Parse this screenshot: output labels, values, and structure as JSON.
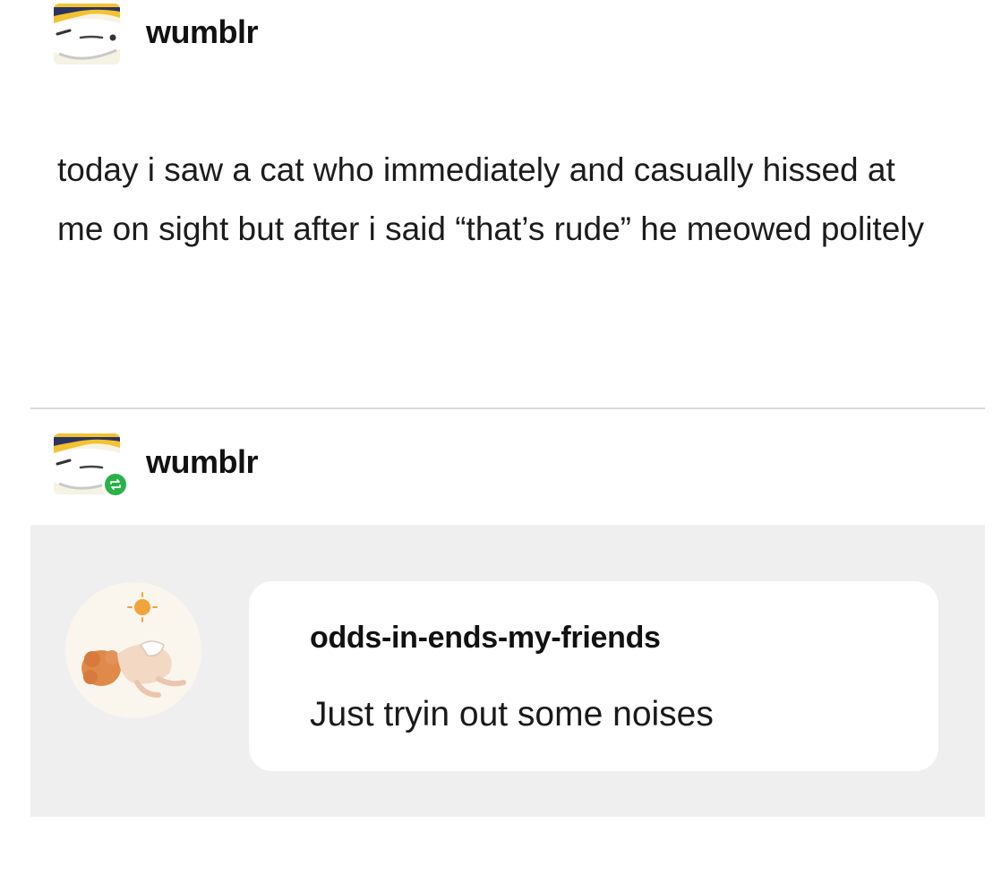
{
  "post": {
    "username": "wumblr",
    "body": "today i saw a cat who immediately and casually hissed at me on sight but after i said “that’s rude” he meowed politely"
  },
  "reblog": {
    "username": "wumblr",
    "reply": {
      "username": "odds-in-ends-my-friends",
      "text": "Just tryin out some noises"
    }
  },
  "colors": {
    "reblog_badge": "#2ab14a",
    "reply_background": "#efefef",
    "bubble_background": "#ffffff"
  }
}
